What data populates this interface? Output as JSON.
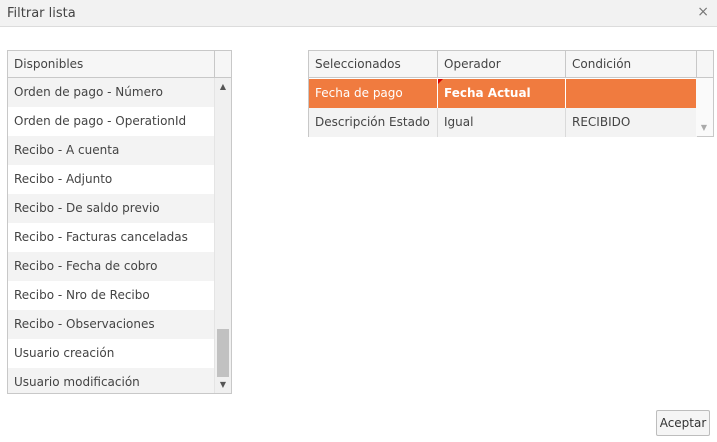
{
  "window": {
    "title": "Filtrar lista",
    "close_glyph": "×"
  },
  "available": {
    "header": "Disponibles",
    "items": [
      "Orden de pago - Número",
      "Orden de pago - OperationId",
      "Recibo - A cuenta",
      "Recibo - Adjunto",
      "Recibo - De saldo previo",
      "Recibo - Facturas canceladas",
      "Recibo - Fecha de cobro",
      "Recibo - Nro de Recibo",
      "Recibo - Observaciones",
      "Usuario creación",
      "Usuario modificación"
    ],
    "scroll_position": 1.0
  },
  "selected": {
    "headers": [
      "Seleccionados",
      "Operador",
      "Condición"
    ],
    "rows": [
      {
        "field": "Fecha de pago",
        "operator": "Fecha Actual",
        "condition": "",
        "selected": true
      },
      {
        "field": "Descripción Estado",
        "operator": "Igual",
        "condition": "RECIBIDO",
        "selected": false
      }
    ]
  },
  "footer": {
    "accept_label": "Aceptar"
  },
  "colors": {
    "selection": "#f07b3f",
    "marker": "#d40000"
  }
}
